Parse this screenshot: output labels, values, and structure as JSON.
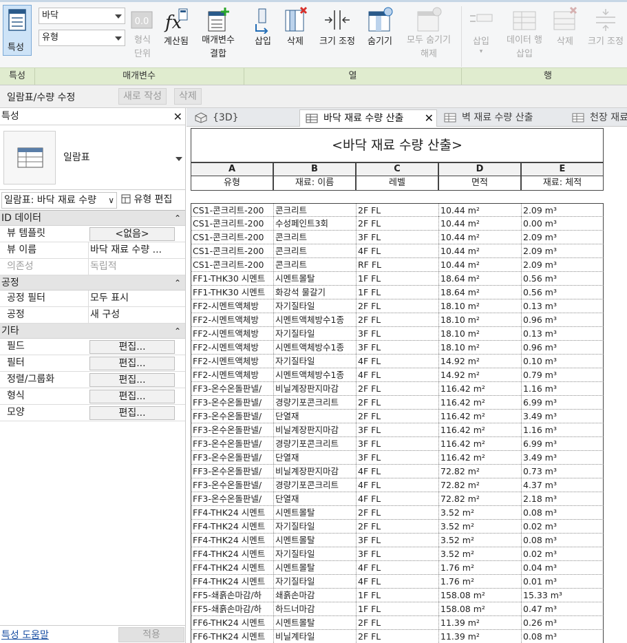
{
  "ribbon": {
    "properties_label": "특성",
    "family_combo": "바닥",
    "type_combo": "유형",
    "format_unit_label": "형식\n단위",
    "calculated_label": "계산됨",
    "combine_params_label": "매개변수\n결합",
    "insert_label": "삽입",
    "delete_label": "삭제",
    "resize_label": "크기 조정",
    "hide_label": "숨기기",
    "unhide_all_label": "모두 숨기기\n해제",
    "row_insert_label": "삽입",
    "insert_data_row_label": "데이터 행\n삽입",
    "row_delete_label": "삭제",
    "row_resize_label": "크기 조정",
    "groups": {
      "properties": "특성",
      "parameters": "매개변수",
      "columns": "열",
      "rows": "행"
    }
  },
  "options_bar": {
    "context": "일람표/수량 수정",
    "new_label": "새로 작성",
    "delete_label": "삭제"
  },
  "properties_panel": {
    "title": "특성",
    "type_name": "일람표",
    "instance_selector": "일람표: 바닥 재료 수량",
    "edit_type": "유형 편집",
    "sections": {
      "identity": "ID 데이터",
      "phasing": "공정",
      "other": "기타"
    },
    "identity_rows": [
      {
        "key": "뷰 템플릿",
        "value": "<없음>"
      },
      {
        "key": "뷰 이름",
        "value": "바닥 재료 수량 ..."
      },
      {
        "key": "의존성",
        "value": "독립적"
      }
    ],
    "phasing_rows": [
      {
        "key": "공정 필터",
        "value": "모두 표시"
      },
      {
        "key": "공정",
        "value": "새 구성"
      }
    ],
    "other_rows": [
      {
        "key": "필드",
        "value": "편집..."
      },
      {
        "key": "필터",
        "value": "편집..."
      },
      {
        "key": "정렬/그룹화",
        "value": "편집..."
      },
      {
        "key": "형식",
        "value": "편집..."
      },
      {
        "key": "모양",
        "value": "편집..."
      }
    ],
    "help_link": "특성 도움말",
    "apply_label": "적용"
  },
  "tabs": [
    {
      "label": "{3D}"
    },
    {
      "label": "바닥 재료 수량 산출"
    },
    {
      "label": "벽 재료 수량 산출"
    },
    {
      "label": "천장 재료"
    }
  ],
  "schedule": {
    "title": "<바닥 재료 수량 산출>",
    "letters": [
      "A",
      "B",
      "C",
      "D",
      "E"
    ],
    "headers": [
      "유형",
      "재료: 이름",
      "레벨",
      "면적",
      "재료: 체적"
    ],
    "rows": [
      [
        "CS1-콘크리트-200",
        "콘크리트",
        "2F FL",
        "10.44 m²",
        "2.09 m³"
      ],
      [
        "CS1-콘크리트-200",
        "수성페인트3회",
        "2F FL",
        "10.44 m²",
        "0.00 m³"
      ],
      [
        "CS1-콘크리트-200",
        "콘크리트",
        "3F FL",
        "10.44 m²",
        "2.09 m³"
      ],
      [
        "CS1-콘크리트-200",
        "콘크리트",
        "4F FL",
        "10.44 m²",
        "2.09 m³"
      ],
      [
        "CS1-콘크리트-200",
        "콘크리트",
        "RF FL",
        "10.44 m²",
        "2.09 m³"
      ],
      [
        "FF1-THK30 시멘트",
        "시멘트몰탈",
        "1F FL",
        "18.64 m²",
        "0.56 m³"
      ],
      [
        "FF1-THK30 시멘트",
        "화강석 물갈기",
        "1F FL",
        "18.64 m²",
        "0.56 m³"
      ],
      [
        "FF2-시멘트액체방",
        "자기질타일",
        "2F FL",
        "18.10 m²",
        "0.13 m³"
      ],
      [
        "FF2-시멘트액체방",
        "시멘트액체방수1종",
        "2F FL",
        "18.10 m²",
        "0.96 m³"
      ],
      [
        "FF2-시멘트액체방",
        "자기질타일",
        "3F FL",
        "18.10 m²",
        "0.13 m³"
      ],
      [
        "FF2-시멘트액체방",
        "시멘트액체방수1종",
        "3F FL",
        "18.10 m²",
        "0.96 m³"
      ],
      [
        "FF2-시멘트액체방",
        "자기질타일",
        "4F FL",
        "14.92 m²",
        "0.10 m³"
      ],
      [
        "FF2-시멘트액체방",
        "시멘트액체방수1종",
        "4F FL",
        "14.92 m²",
        "0.79 m³"
      ],
      [
        "FF3-온수온돌판넬/",
        "비닐계장판지마감",
        "2F FL",
        "116.42 m²",
        "1.16 m³"
      ],
      [
        "FF3-온수온돌판넬/",
        "경량기포콘크리트",
        "2F FL",
        "116.42 m²",
        "6.99 m³"
      ],
      [
        "FF3-온수온돌판넬/",
        "단열재",
        "2F FL",
        "116.42 m²",
        "3.49 m³"
      ],
      [
        "FF3-온수온돌판넬/",
        "비닐계장판지마감",
        "3F FL",
        "116.42 m²",
        "1.16 m³"
      ],
      [
        "FF3-온수온돌판넬/",
        "경량기포콘크리트",
        "3F FL",
        "116.42 m²",
        "6.99 m³"
      ],
      [
        "FF3-온수온돌판넬/",
        "단열재",
        "3F FL",
        "116.42 m²",
        "3.49 m³"
      ],
      [
        "FF3-온수온돌판넬/",
        "비닐계장판지마감",
        "4F FL",
        "72.82 m²",
        "0.73 m³"
      ],
      [
        "FF3-온수온돌판넬/",
        "경량기포콘크리트",
        "4F FL",
        "72.82 m²",
        "4.37 m³"
      ],
      [
        "FF3-온수온돌판넬/",
        "단열재",
        "4F FL",
        "72.82 m²",
        "2.18 m³"
      ],
      [
        "FF4-THK24 시멘트",
        "시멘트몰탈",
        "2F FL",
        "3.52 m²",
        "0.08 m³"
      ],
      [
        "FF4-THK24 시멘트",
        "자기질타일",
        "2F FL",
        "3.52 m²",
        "0.02 m³"
      ],
      [
        "FF4-THK24 시멘트",
        "시멘트몰탈",
        "3F FL",
        "3.52 m²",
        "0.08 m³"
      ],
      [
        "FF4-THK24 시멘트",
        "자기질타일",
        "3F FL",
        "3.52 m²",
        "0.02 m³"
      ],
      [
        "FF4-THK24 시멘트",
        "시멘트몰탈",
        "4F FL",
        "1.76 m²",
        "0.04 m³"
      ],
      [
        "FF4-THK24 시멘트",
        "자기질타일",
        "4F FL",
        "1.76 m²",
        "0.01 m³"
      ],
      [
        "FF5-쇄흙손마감/하",
        "쇄흙손마감",
        "1F FL",
        "158.08 m²",
        "15.33 m³"
      ],
      [
        "FF5-쇄흙손마감/하",
        "하드너마감",
        "1F FL",
        "158.08 m²",
        "0.47 m³"
      ],
      [
        "FF6-THK24 시멘트",
        "시멘트몰탈",
        "2F FL",
        "11.39 m²",
        "0.26 m³"
      ],
      [
        "FF6-THK24 시멘트",
        "비닐계타일",
        "2F FL",
        "11.39 m²",
        "0.08 m³"
      ]
    ]
  },
  "colors": {
    "ribbon_group_bar": "#e0eccf",
    "active_button": "#cde3f7",
    "accent_blue": "#1f6bb5",
    "delete_red": "#d9302a",
    "add_green": "#2aa62a"
  }
}
